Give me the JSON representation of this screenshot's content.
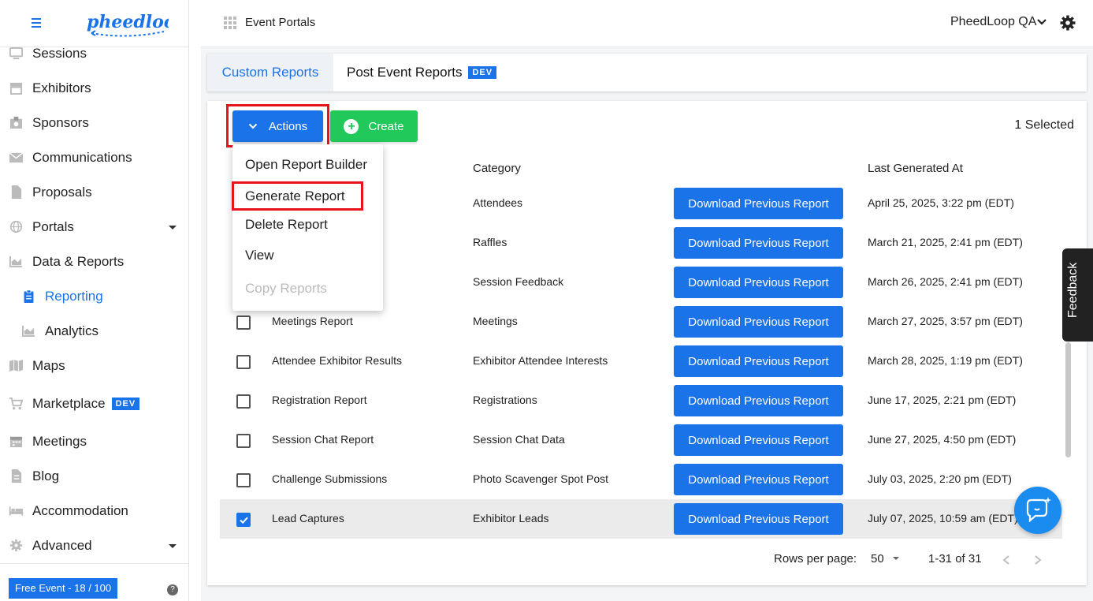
{
  "sidebar": {
    "logo_text": "pheedloop",
    "items": [
      {
        "label": "Sessions",
        "icon": "monitor-icon",
        "name": "sidebar-item-sessions"
      },
      {
        "label": "Exhibitors",
        "icon": "store-icon",
        "name": "sidebar-item-exhibitors"
      },
      {
        "label": "Sponsors",
        "icon": "badge-icon",
        "name": "sidebar-item-sponsors"
      },
      {
        "label": "Communications",
        "icon": "mail-icon",
        "name": "sidebar-item-communications"
      },
      {
        "label": "Proposals",
        "icon": "file-icon",
        "name": "sidebar-item-proposals"
      },
      {
        "label": "Portals",
        "icon": "globe-icon",
        "name": "sidebar-item-portals"
      },
      {
        "label": "Data & Reports",
        "icon": "chart-icon",
        "name": "sidebar-item-data-reports"
      },
      {
        "label": "Reporting",
        "icon": "clipboard-icon",
        "name": "sidebar-item-reporting"
      },
      {
        "label": "Analytics",
        "icon": "chart-icon",
        "name": "sidebar-item-analytics"
      },
      {
        "label": "Maps",
        "icon": "map-icon",
        "name": "sidebar-item-maps"
      },
      {
        "label": "Marketplace",
        "icon": "cart-icon",
        "name": "sidebar-item-marketplace",
        "badge": "DEV"
      },
      {
        "label": "Meetings",
        "icon": "calendar-icon",
        "name": "sidebar-item-meetings"
      },
      {
        "label": "Blog",
        "icon": "document-icon",
        "name": "sidebar-item-blog"
      },
      {
        "label": "Accommodation",
        "icon": "bed-icon",
        "name": "sidebar-item-accommodation"
      },
      {
        "label": "Advanced",
        "icon": "gear-icon",
        "name": "sidebar-item-advanced"
      }
    ],
    "footer_badge": "Free Event - 18 / 100",
    "help": "?"
  },
  "topbar": {
    "title": "Event Portals",
    "org": "PheedLoop QA"
  },
  "tabs": {
    "custom": "Custom Reports",
    "post_event": "Post Event Reports",
    "dev_badge": "DEV"
  },
  "toolbar": {
    "actions_label": "Actions",
    "create_label": "Create",
    "selected_text": "1 Selected"
  },
  "table": {
    "headers": {
      "category": "Category",
      "last_generated": "Last Generated At"
    },
    "download_label": "Download Previous Report",
    "rows": [
      {
        "name": "",
        "category": "Attendees",
        "date": "April 25, 2025, 3:22 pm (EDT)"
      },
      {
        "name": "",
        "category": "Raffles",
        "date": "March 21, 2025, 2:41 pm (EDT)"
      },
      {
        "name": "",
        "category": "Session Feedback",
        "date": "March 26, 2025, 2:41 pm (EDT)"
      },
      {
        "name": "Meetings Report",
        "category": "Meetings",
        "date": "March 27, 2025, 3:57 pm (EDT)"
      },
      {
        "name": "Attendee Exhibitor Results",
        "category": "Exhibitor Attendee Interests",
        "date": "March 28, 2025, 1:19 pm (EDT)"
      },
      {
        "name": "Registration Report",
        "category": "Registrations",
        "date": "June 17, 2025, 2:21 pm (EDT)"
      },
      {
        "name": "Session Chat Report",
        "category": "Session Chat Data",
        "date": "June 27, 2025, 4:50 pm (EDT)"
      },
      {
        "name": "Challenge Submissions",
        "category": "Photo Scavenger Spot Post",
        "date": "July 03, 2025, 2:20 pm (EDT)"
      },
      {
        "name": "Lead Captures",
        "category": "Exhibitor Leads",
        "date": "July 07, 2025, 10:59 am (EDT)",
        "checked": true
      }
    ]
  },
  "pagination": {
    "rows_per_page_label": "Rows per page:",
    "rows_per_page": "50",
    "range": "1-31 of 31"
  },
  "actions_menu": {
    "items": [
      "Open Report Builder",
      "Generate Report",
      "Delete Report",
      "View",
      "Copy Reports"
    ]
  },
  "feedback_label": "Feedback",
  "colors": {
    "accent": "#1a73e8",
    "create": "#21c85a",
    "highlight": "#e8141c"
  }
}
